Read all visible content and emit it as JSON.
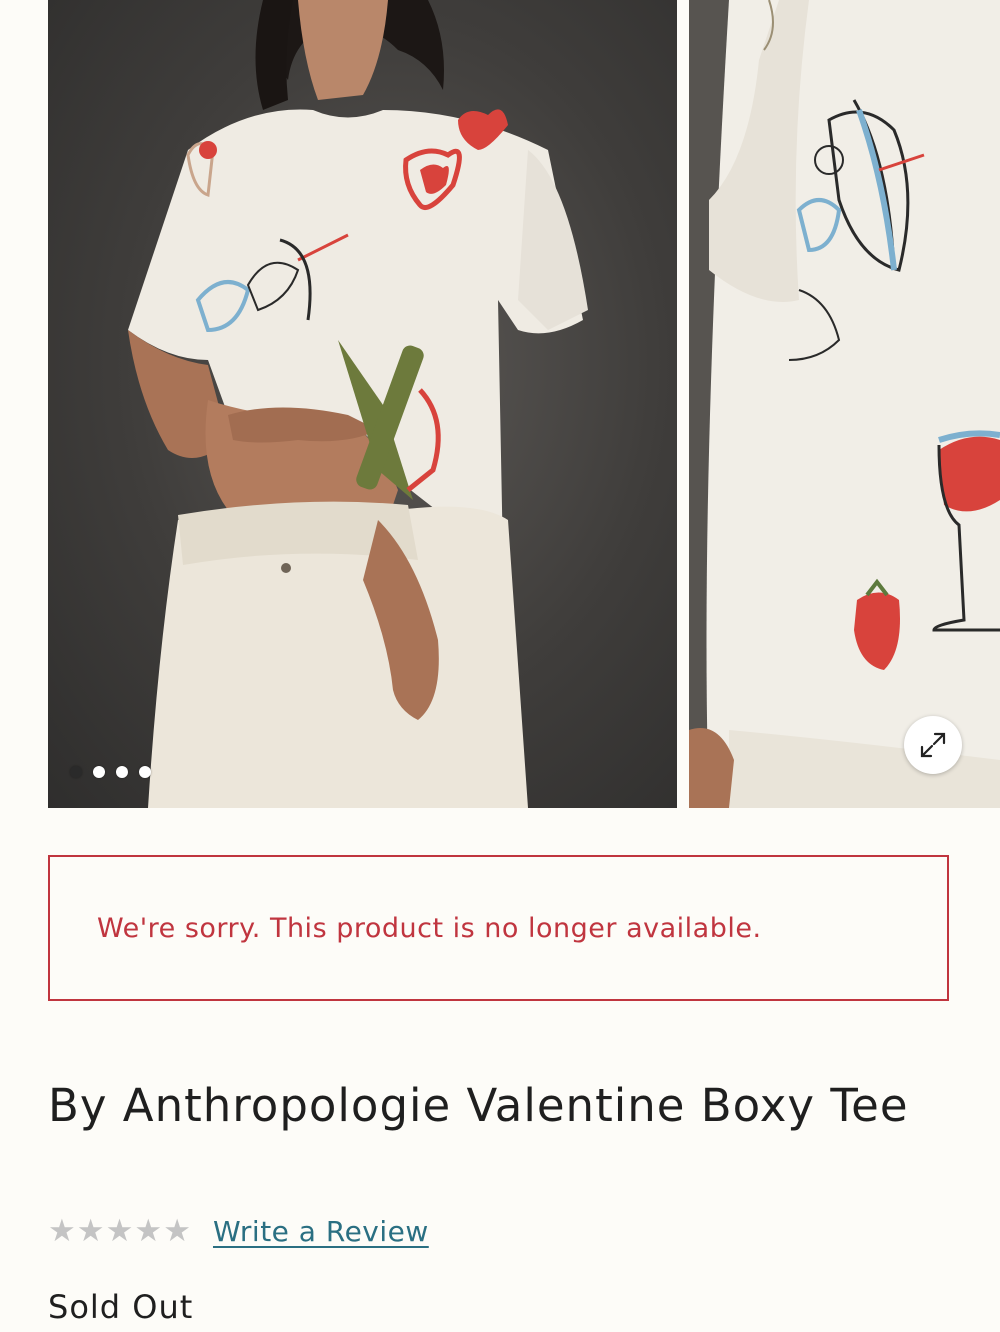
{
  "gallery": {
    "slide_count": 4,
    "active_slide": 1,
    "expand_icon": "expand-arrows-icon"
  },
  "alert": {
    "message": "We're sorry. This product is no longer available.",
    "color": "#c0353f"
  },
  "product": {
    "title": "By Anthropologie Valentine Boxy Tee",
    "rating_stars": 0,
    "rating_max": 5,
    "write_review_label": "Write a Review",
    "availability": "Sold Out"
  },
  "colors": {
    "background": "#fdfcf8",
    "link": "#2a6f82",
    "star_empty": "#c4c4c4",
    "text": "#1f1f1f"
  }
}
